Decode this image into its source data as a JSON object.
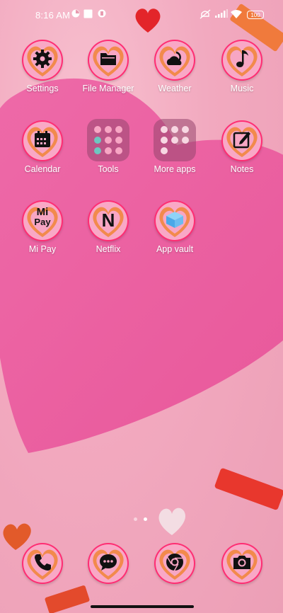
{
  "status_bar": {
    "time": "8:16 AM",
    "battery": "100",
    "icons": [
      "notification-badge-icon",
      "stop-square-icon",
      "app-badge-icon",
      "mute-icon",
      "signal-icon",
      "wifi-icon",
      "battery-icon"
    ]
  },
  "apps": {
    "settings": "Settings",
    "file_manager": "File Manager",
    "weather": "Weather",
    "music": "Music",
    "calendar": "Calendar",
    "tools": "Tools",
    "more_apps": "More apps",
    "notes": "Notes",
    "mi_pay": "Mi Pay",
    "netflix": "Netflix",
    "app_vault": "App vault"
  },
  "glyph_text": {
    "mi_pay_top": "Mi",
    "mi_pay_bottom": "Pay",
    "netflix": "N"
  },
  "dock": [
    "phone-icon",
    "messages-icon",
    "chrome-icon",
    "camera-icon"
  ],
  "page_indicator": {
    "pages": 2,
    "active": 2
  },
  "colors": {
    "icon_ring": "#ff2d73",
    "icon_heart_outer": "#f28a4c",
    "icon_heart_inner": "#f7a6c4",
    "wallpaper": "#f2a9bf",
    "big_heart": "#ea5fa0"
  }
}
